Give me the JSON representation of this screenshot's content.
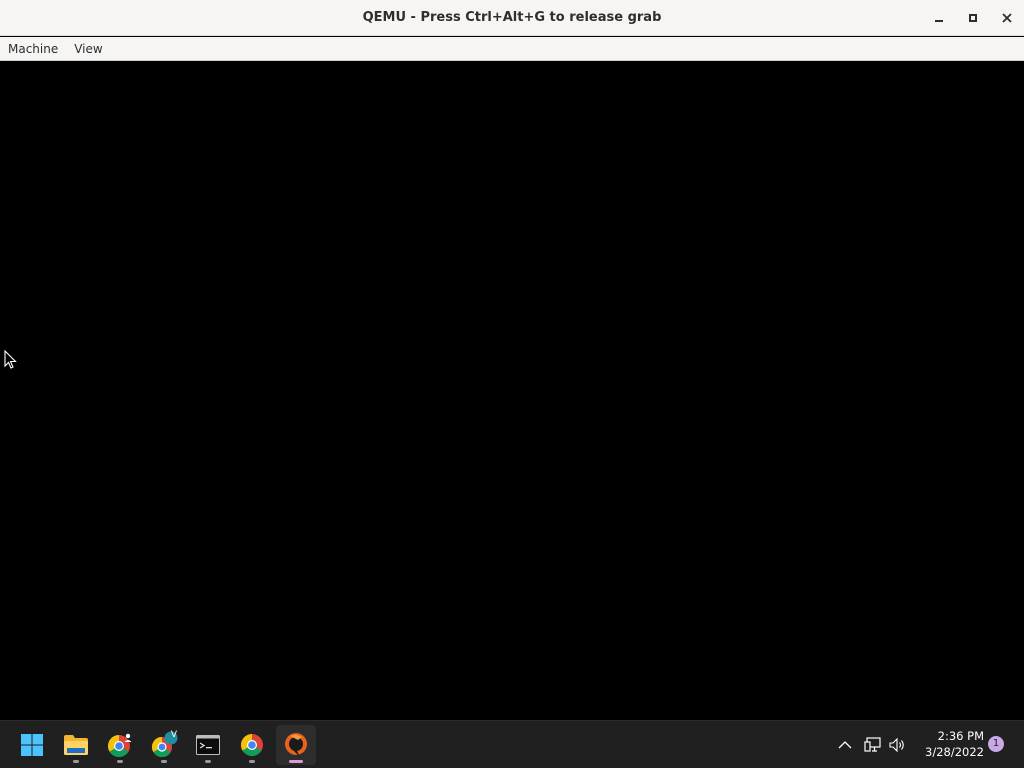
{
  "window": {
    "title": "QEMU - Press Ctrl+Alt+G to release grab",
    "controls": [
      "minimize-icon",
      "maximize-icon",
      "close-icon"
    ]
  },
  "menubar": {
    "items": [
      {
        "label": "Machine"
      },
      {
        "label": "View"
      }
    ]
  },
  "taskbar": {
    "apps": [
      {
        "name": "start",
        "icon": "windows-start-icon"
      },
      {
        "name": "file-explorer",
        "icon": "folder-icon"
      },
      {
        "name": "chrome-profile",
        "icon": "chrome-icon"
      },
      {
        "name": "chrome-profile-v",
        "icon": "chrome-icon",
        "badge": "V"
      },
      {
        "name": "terminal",
        "icon": "terminal-icon"
      },
      {
        "name": "chrome",
        "icon": "chrome-icon"
      },
      {
        "name": "qemu",
        "icon": "qemu-icon",
        "active": true
      }
    ],
    "tray": {
      "time": "2:36 PM",
      "date": "3/28/2022",
      "notifications": "1"
    }
  },
  "colors": {
    "titlebar_bg": "#f6f5f4",
    "taskbar_bg": "#202020",
    "active_indicator": "#d89cd6",
    "screen_bg": "#000000"
  }
}
